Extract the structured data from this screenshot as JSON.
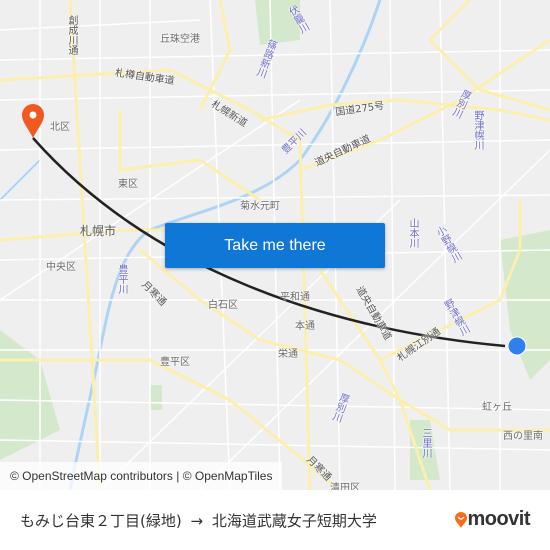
{
  "map": {
    "labels": {
      "kita_ku": "北区",
      "higashi_ku": "東区",
      "sapporo_shi": "札幌市",
      "chuo_ku": "中央区",
      "shiroishi_ku": "白石区",
      "toyohira_ku": "豊平区",
      "kiyota_ku": "清田区",
      "okadama": "丘珠空港",
      "kikusui": "菊水元町",
      "heiwa": "平和通",
      "hondori": "本通",
      "sakae": "栄通",
      "nijigaoka": "虹ヶ丘",
      "nishinosato": "西の里南"
    },
    "roads": {
      "sosei": "創成川通",
      "sataru": "札樽自動車道",
      "sapporo_shindo": "札幌新道",
      "route275": "国道275号",
      "doou": "道央自動車道",
      "doou2": "道央自動車道",
      "tsukisamu": "月寒通",
      "tsukisamu2": "月寒通",
      "atsubetsu_road": "札幌江別通"
    },
    "rivers": {
      "fushiko": "伏籠川",
      "nanbu": "篠路新川",
      "toyohira": "豊平川",
      "toyohira2": "豊平川",
      "atsubetsu": "厚別川",
      "nopporo": "野津幌川",
      "yamamoto": "山本川",
      "komiyama": "小野幌川",
      "mitsusato": "三里川",
      "nopporo2": "野津幌川",
      "atsubetsu2": "厚別川"
    },
    "colors": {
      "route": "#222222",
      "origin": "#2f80ed",
      "destination_pin": "#f05a1e",
      "road": "#fdf2b6",
      "water": "#aed4f5",
      "park": "#c9e4c1"
    }
  },
  "button": {
    "label": "Take me there"
  },
  "attribution": "© OpenStreetMap contributors | © OpenMapTiles",
  "footer": {
    "origin": "もみじ台東２丁目(緑地)",
    "arrow": "→",
    "destination": "北海道武蔵女子短期大学"
  },
  "brand": {
    "name": "moovit",
    "color": "#f96b1b"
  }
}
